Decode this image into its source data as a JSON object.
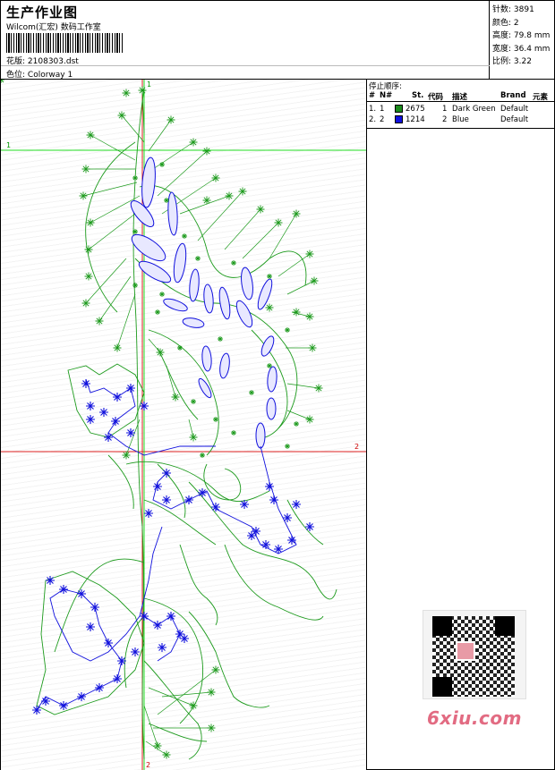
{
  "header": {
    "title": "生产作业图",
    "company": "Wilcom(汇宏) 数码工作室",
    "design_label": "花版:",
    "design_file": "2108303.dst",
    "colorway_label": "色位:",
    "colorway": "Colorway 1"
  },
  "stats": [
    {
      "label": "针数:",
      "value": "3891"
    },
    {
      "label": "颜色:",
      "value": "2"
    },
    {
      "label": "高度:",
      "value": "79.8 mm"
    },
    {
      "label": "宽度:",
      "value": "36.4 mm"
    },
    {
      "label": "比例:",
      "value": "3.22"
    }
  ],
  "guides": {
    "vertical_labels": [
      "1",
      "2"
    ],
    "horizontal_labels": [
      "1",
      "2"
    ],
    "colors": {
      "guide1": "#00cc00",
      "guide2": "#dd0000"
    }
  },
  "stop_order": {
    "title": "停止顺序:",
    "headers": {
      "num": "#",
      "no": "N#",
      "st": "St.",
      "code": "代码",
      "desc": "描述",
      "brand": "Brand",
      "elem": "元素"
    },
    "rows": [
      {
        "num": "1.",
        "no": "1",
        "color": "#1a8a1a",
        "st": "2675",
        "code": "1",
        "desc": "Dark Green",
        "brand": "Default"
      },
      {
        "num": "2.",
        "no": "2",
        "color": "#1010dd",
        "st": "1214",
        "code": "2",
        "desc": "Blue",
        "brand": "Default"
      }
    ]
  },
  "watermark": {
    "site": "6xiu.com"
  }
}
